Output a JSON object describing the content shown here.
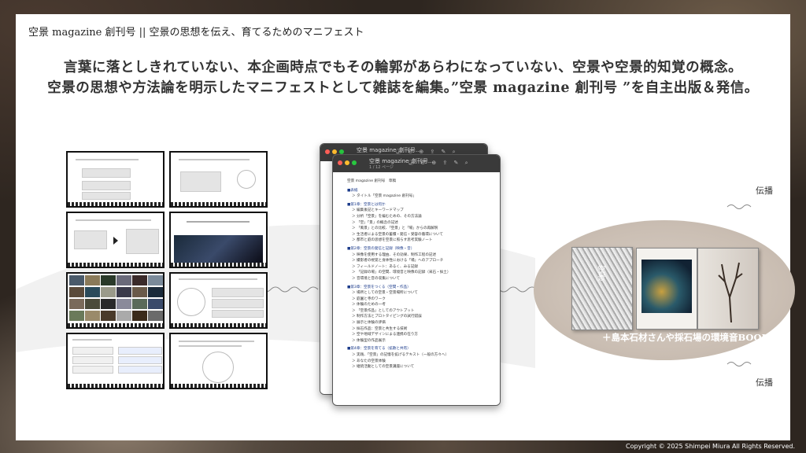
{
  "header": {
    "title": "空景 magazine 創刊号 || 空景の思想を伝え、育てるためのマニフェスト"
  },
  "headline": {
    "line1": "言葉に落としきれていない、本企画時点でもその輪郭があらわになっていない、空景や空景的知覚の概念。",
    "line2": "空景の思想や方法論を明示したマニフェストとして雑誌を編集。”空景 magazine 創刊号 ”を自主出版＆発信。"
  },
  "window": {
    "title": "空景 magazine_創刊号...",
    "subtitle": "1 / 12 ページ",
    "toolbar_icons": "ⓘ ⊖ ⊕ ⇪ ✎ ⌕"
  },
  "document": {
    "lines": [
      {
        "kind": "title",
        "text": "空景 magazine 創刊号　草稿"
      },
      {
        "kind": "sec",
        "text": "■表紙"
      },
      {
        "kind": "item",
        "text": "＞ タイトル「空景 magazine 創刊号」"
      },
      {
        "kind": "sec",
        "text": "■第1章：空景とは何か"
      },
      {
        "kind": "item",
        "text": "＞ 編集後記とキーワードマップ"
      },
      {
        "kind": "item",
        "text": "＞ 分析「空景」を編むための、その方法論"
      },
      {
        "kind": "item",
        "text": "＞ 「空」「景」の概念の記述"
      },
      {
        "kind": "item",
        "text": "＞ 「風景」との比較、「空景」と「場」からの再解釈"
      },
      {
        "kind": "item",
        "text": "＞ 生活者による空景の蓄積・発信・受容の循環について"
      },
      {
        "kind": "item",
        "text": "＞ 都市と庭の思想を空景に照らす思考実験ノート"
      },
      {
        "kind": "sec",
        "text": "■第2章：空景の発信と記録（映像・音）"
      },
      {
        "kind": "item",
        "text": "＞ 映像を使用する理由、その効果、制作工程の記述"
      },
      {
        "kind": "item",
        "text": "＞ 撮影者の視覚と身体性における「場」へのアプローチ"
      },
      {
        "kind": "item",
        "text": "＞ フィールドノート：あるく、みる記録"
      },
      {
        "kind": "item",
        "text": "＞ 「記録の場」の空間、環境音と映像の記録（采石・採土）"
      },
      {
        "kind": "item",
        "text": "＞ 音環境と音の収集について"
      },
      {
        "kind": "sec",
        "text": "■第3章：空景をつくる（空間・作品）"
      },
      {
        "kind": "item",
        "text": "＞ 場所としての空景・空景場所について"
      },
      {
        "kind": "item",
        "text": "＞ 庭園と寺のワーク"
      },
      {
        "kind": "item",
        "text": "＞ 体験のための一考"
      },
      {
        "kind": "item",
        "text": "＞ 「空景作品」としてのアウトプット"
      },
      {
        "kind": "item",
        "text": "＞ 制作方法とプロトタイピングの試行錯誤"
      },
      {
        "kind": "item",
        "text": "＞ 展示と体験の評価"
      },
      {
        "kind": "item",
        "text": "＞ 採石作品：空景と共生する技術"
      },
      {
        "kind": "item",
        "text": "＞ 空や地域デザインによる連携の在り方"
      },
      {
        "kind": "item",
        "text": "＞ 体験型の作品展示"
      },
      {
        "kind": "sec",
        "text": "■第4章：空景を育てる（拡散と共有）"
      },
      {
        "kind": "item",
        "text": "＞ 実践、「空景」の記憶を拡げるテキスト（一般の方々へ）"
      },
      {
        "kind": "item",
        "text": "＞ あなたの空景体験"
      },
      {
        "kind": "item",
        "text": "＞ 継続活動としての空景講座について"
      }
    ]
  },
  "books": {
    "cover_title": "空景"
  },
  "caption": "＋島本石材さんや採石場の環境音BOOK",
  "labels": {
    "top": "伝播",
    "bottom": "伝播"
  },
  "copyright": "Copyright © 2025 Shimpei Miura All Rights Reserved.",
  "colors": {
    "section_heading": "#1a3a8a",
    "traffic_red": "#ff5f57",
    "traffic_yellow": "#febc2e",
    "traffic_green": "#28c840"
  }
}
